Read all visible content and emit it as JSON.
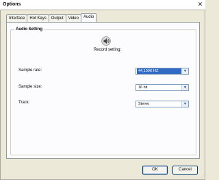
{
  "window": {
    "title": "Options"
  },
  "tabs": [
    {
      "label": "Interface"
    },
    {
      "label": "Hot Keys"
    },
    {
      "label": "Output"
    },
    {
      "label": "Video"
    },
    {
      "label": "Audio"
    }
  ],
  "active_tab": "Audio",
  "audio": {
    "group_title": "Audio Setting",
    "record_label": "Record setting:",
    "sample_rate": {
      "label": "Sample rate:",
      "value": "44,100K HZ"
    },
    "sample_size": {
      "label": "Sample size:",
      "value": "16 bit"
    },
    "track": {
      "label": "Track:",
      "value": "Stereo"
    }
  },
  "buttons": {
    "ok": "OK",
    "cancel": "Cancel"
  },
  "icons": {
    "speaker": "speaker-icon",
    "close": "close-icon",
    "dropdown": "chevron-down-icon"
  },
  "colors": {
    "face": "#ece9d8",
    "selection": "#316ac5",
    "panel": "#fcfcfe"
  }
}
